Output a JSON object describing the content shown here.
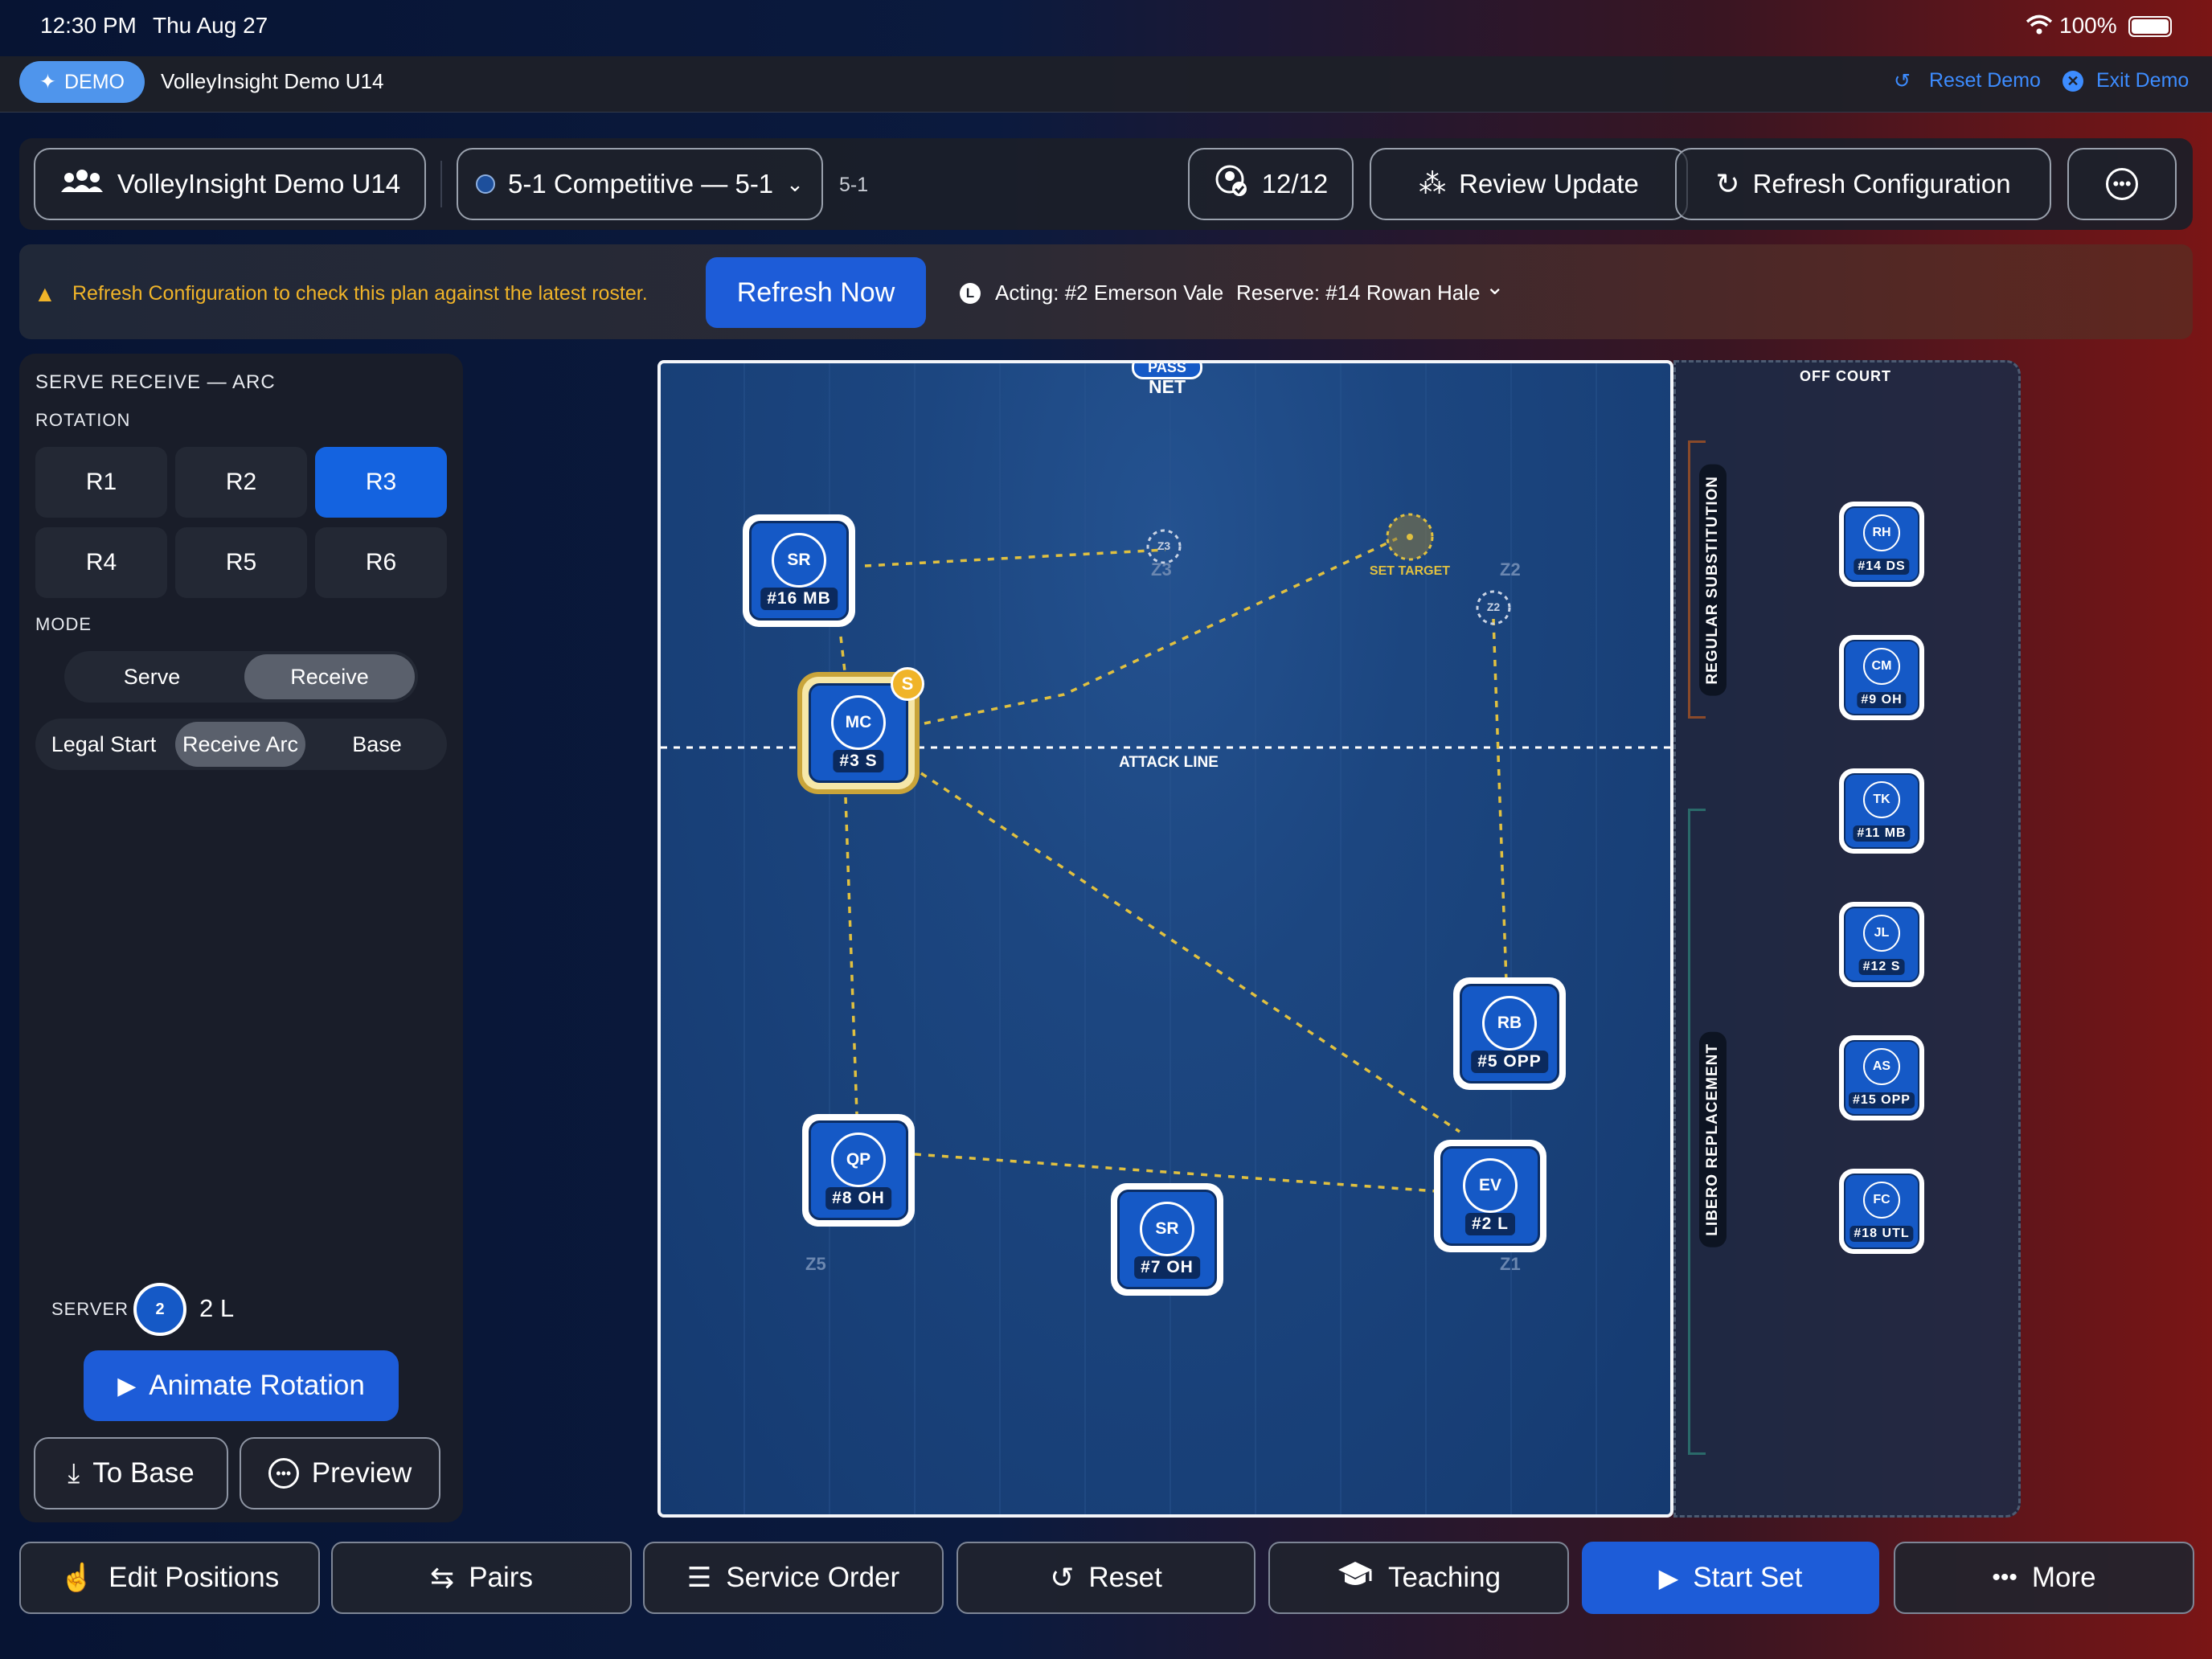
{
  "status": {
    "time": "12:30 PM",
    "date": "Thu Aug 27",
    "battery": "100%"
  },
  "demo": {
    "badge": "DEMO",
    "title": "VolleyInsight Demo U14",
    "reset": "Reset Demo",
    "exit": "Exit Demo"
  },
  "toolbar": {
    "team": "VolleyInsight Demo U14",
    "system": "5-1 Competitive — 5-1",
    "system_short": "5-1",
    "roster": "12/12",
    "review": "Review Update",
    "refresh": "Refresh Configuration"
  },
  "banner": {
    "message": "Refresh Configuration to check this plan against the latest roster.",
    "button": "Refresh Now",
    "badge": "L",
    "acting": "Acting: #2 Emerson Vale",
    "reserve": "Reserve: #14 Rowan Hale"
  },
  "panel": {
    "heading": "SERVE RECEIVE — ARC",
    "rotation_label": "ROTATION",
    "rotations": [
      "R1",
      "R2",
      "R3",
      "R4",
      "R5",
      "R6"
    ],
    "selected_rotation": "R3",
    "mode_label": "MODE",
    "modes": [
      "Serve",
      "Receive"
    ],
    "selected_mode": "Receive",
    "views": [
      "Legal Start",
      "Receive Arc",
      "Base"
    ],
    "selected_view": "Receive Arc",
    "server_label": "SERVER",
    "server_num": "2",
    "server_name": "2 L",
    "animate": "Animate Rotation",
    "to_base": "To Base",
    "preview": "Preview"
  },
  "court": {
    "pass_tag": "PASS",
    "net": "NET",
    "attack_line": "ATTACK LINE",
    "set_target": "SET TARGET",
    "setter_badge": "S",
    "zones": {
      "z1": "Z1",
      "z2": "Z2",
      "z3": "Z3",
      "z5": "Z5"
    },
    "ghosts": {
      "z2": "Z2",
      "z3": "Z3"
    },
    "players": [
      {
        "initials": "SR",
        "pos": "#16 MB"
      },
      {
        "initials": "MC",
        "pos": "#3 S"
      },
      {
        "initials": "RB",
        "pos": "#5 OPP"
      },
      {
        "initials": "QP",
        "pos": "#8 OH"
      },
      {
        "initials": "SR",
        "pos": "#7 OH"
      },
      {
        "initials": "EV",
        "pos": "#2 L"
      }
    ]
  },
  "offcourt": {
    "title": "OFF COURT",
    "sub_label": "REGULAR SUBSTITUTION",
    "libero_label": "LIBERO REPLACEMENT",
    "players": [
      {
        "initials": "RH",
        "pos": "#14 DS"
      },
      {
        "initials": "CM",
        "pos": "#9 OH"
      },
      {
        "initials": "TK",
        "pos": "#11 MB"
      },
      {
        "initials": "JL",
        "pos": "#12 S"
      },
      {
        "initials": "AS",
        "pos": "#15 OPP"
      },
      {
        "initials": "FC",
        "pos": "#18 UTL"
      }
    ]
  },
  "nav": {
    "edit": "Edit Positions",
    "pairs": "Pairs",
    "service": "Service Order",
    "reset": "Reset",
    "teaching": "Teaching",
    "start": "Start Set",
    "more": "More"
  },
  "colors": {
    "accent": "#1d5cd8",
    "setter_ring": "#c9a43a",
    "warning": "#f0b429",
    "dashed_line": "#e0c040"
  }
}
